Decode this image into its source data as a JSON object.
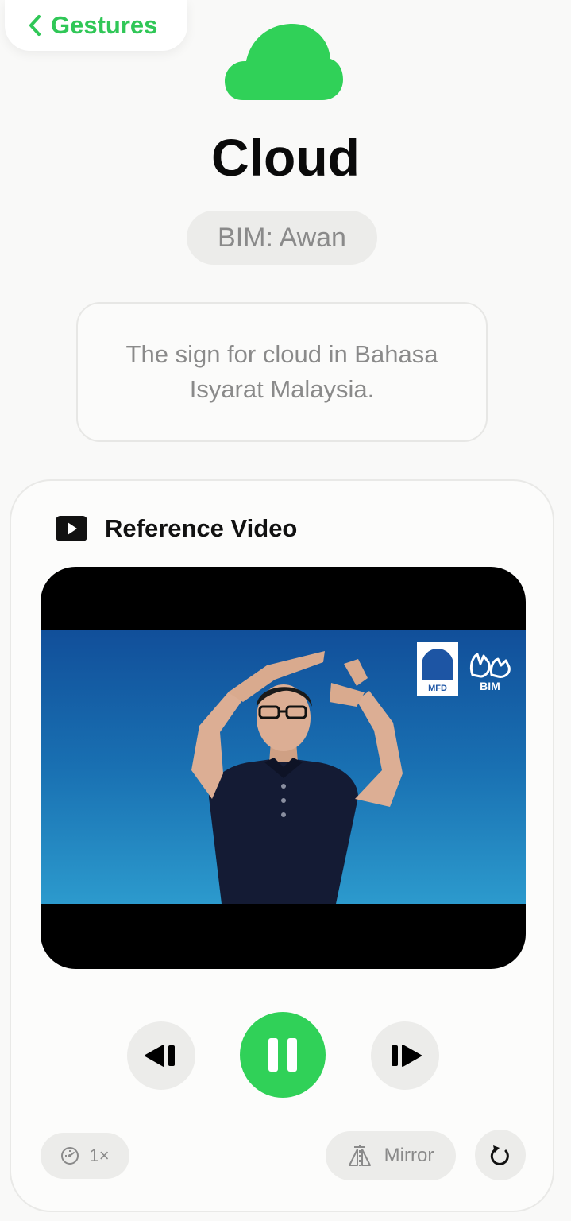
{
  "nav": {
    "back_label": "Gestures"
  },
  "hero": {
    "icon": "cloud-icon",
    "icon_color": "#30d158"
  },
  "sign": {
    "title": "Cloud",
    "bim_label": "BIM: Awan",
    "description": "The sign for cloud in Bahasa Isyarat Malaysia."
  },
  "video": {
    "header_icon": "play-rectangle-icon",
    "header_title": "Reference Video",
    "logos": {
      "mfd": "MFD",
      "bim": "BIM"
    },
    "state": "playing",
    "controls": {
      "previous_icon": "step-back-icon",
      "play_pause_icon": "pause-icon",
      "next_icon": "step-forward-icon"
    },
    "speed_label": "1×",
    "mirror_label": "Mirror",
    "replay_icon": "replay-icon"
  },
  "colors": {
    "accent": "#30d158",
    "back_text": "#30c757",
    "chip_bg": "#ececea",
    "muted_text": "#8a8a8a",
    "video_bg_top": "#114f9a",
    "video_bg_bottom": "#2c9acd"
  }
}
